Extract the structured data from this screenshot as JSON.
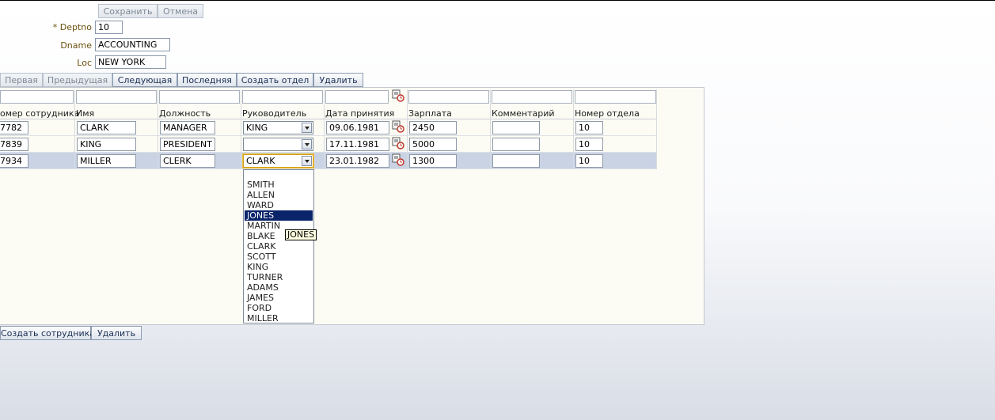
{
  "form": {
    "save_label": "Сохранить",
    "cancel_label": "Отмена",
    "deptno_label": "* Deptno",
    "deptno_value": "10",
    "dname_label": "Dname",
    "dname_value": "ACCOUNTING",
    "loc_label": "Loc",
    "loc_value": "NEW YORK"
  },
  "nav": {
    "first": "Первая",
    "prev": "Предыдущая",
    "next": "Следующая",
    "last": "Последняя",
    "create_dept": "Создать отдел",
    "delete": "Удалить"
  },
  "table": {
    "headers": [
      "омер сотрудника",
      "Имя",
      "Должность",
      "Руководитель",
      "Дата принятия",
      "Зарплата",
      "Комментарий",
      "Номер отдела"
    ],
    "rows": [
      {
        "empno": "7782",
        "ename": "CLARK",
        "job": "MANAGER",
        "mgr": "KING",
        "hiredate": "09.06.1981",
        "sal": "2450",
        "comm": "",
        "deptno": "10"
      },
      {
        "empno": "7839",
        "ename": "KING",
        "job": "PRESIDENT",
        "mgr": "",
        "hiredate": "17.11.1981",
        "sal": "5000",
        "comm": "",
        "deptno": "10"
      },
      {
        "empno": "7934",
        "ename": "MILLER",
        "job": "CLERK",
        "mgr": "CLARK",
        "hiredate": "23.01.1982",
        "sal": "1300",
        "comm": "",
        "deptno": "10"
      }
    ]
  },
  "dropdown": {
    "options": [
      "",
      "SMITH",
      "ALLEN",
      "WARD",
      "JONES",
      "MARTIN",
      "BLAKE",
      "CLARK",
      "SCOTT",
      "KING",
      "TURNER",
      "ADAMS",
      "JAMES",
      "FORD",
      "MILLER"
    ],
    "highlighted": "JONES",
    "tooltip": "JONES"
  },
  "bottom": {
    "create_emp": "Создать сотрудника",
    "delete": "Удалить"
  },
  "icons": {
    "calendar": "calendar-icon",
    "dropdown": "chevron-down-icon"
  }
}
